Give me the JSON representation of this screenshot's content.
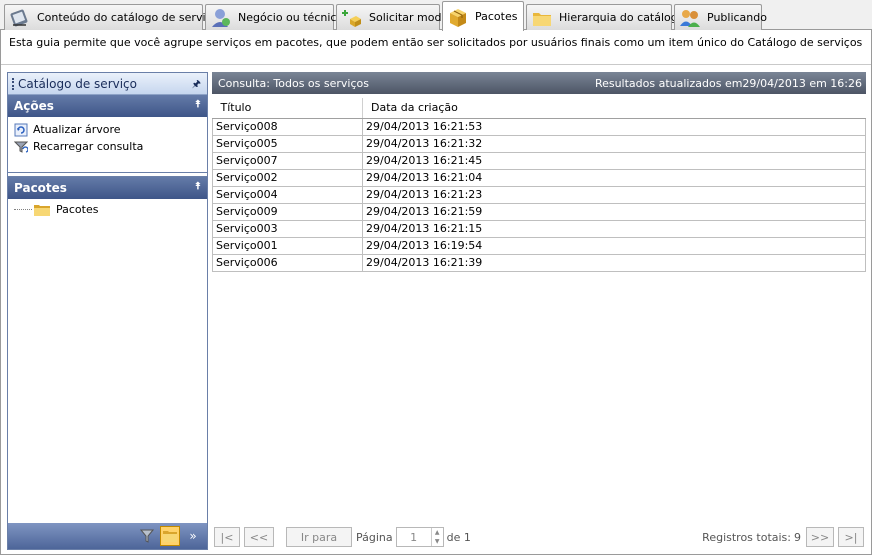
{
  "tabs": [
    {
      "label": "Conteúdo do catálogo de serviço",
      "icon": "catalog-notebook-icon"
    },
    {
      "label": "Negócio ou técnico",
      "icon": "business-person-icon"
    },
    {
      "label": "Solicitar modo",
      "icon": "request-box-plus-icon"
    },
    {
      "label": "Pacotes",
      "icon": "package-box-icon",
      "active": true
    },
    {
      "label": "Hierarquia do catálogo",
      "icon": "folder-icon"
    },
    {
      "label": "Publicando",
      "icon": "people-icon"
    }
  ],
  "description": "Esta guia permite que você agrupe serviços em pacotes, que podem então ser solicitados por usuários finais como um item único do Catálogo de serviços",
  "left_panel": {
    "title": "Catálogo de serviço",
    "actions_title": "Ações",
    "actions": [
      {
        "label": "Atualizar árvore",
        "icon": "refresh-icon"
      },
      {
        "label": "Recarregar consulta",
        "icon": "reload-query-icon"
      }
    ],
    "packages_title": "Pacotes",
    "tree": [
      {
        "label": "Pacotes",
        "icon": "folder-icon"
      }
    ]
  },
  "query": {
    "title": "Consulta: Todos os serviços",
    "updated": "Resultados atualizados em29/04/2013 em 16:26"
  },
  "table": {
    "columns": [
      "Título",
      "Data da criação"
    ],
    "rows": [
      [
        "Serviço008",
        "29/04/2013 16:21:53"
      ],
      [
        "Serviço005",
        "29/04/2013 16:21:32"
      ],
      [
        "Serviço007",
        "29/04/2013 16:21:45"
      ],
      [
        "Serviço002",
        "29/04/2013 16:21:04"
      ],
      [
        "Serviço004",
        "29/04/2013 16:21:23"
      ],
      [
        "Serviço009",
        "29/04/2013 16:21:59"
      ],
      [
        "Serviço003",
        "29/04/2013 16:21:15"
      ],
      [
        "Serviço001",
        "29/04/2013 16:19:54"
      ],
      [
        "Serviço006",
        "29/04/2013 16:21:39"
      ]
    ]
  },
  "pager": {
    "first": "|<",
    "prev": "<<",
    "goto": "Ir para",
    "page_label": "Página",
    "page_value": "1",
    "of_label": "de 1",
    "total_label": "Registros totais:",
    "total_value": "9",
    "next": ">>",
    "last": ">|"
  },
  "colors": {
    "section_header": "#3e5588",
    "grid_header": "#4d5565",
    "selected_button": "#ffd26a"
  }
}
